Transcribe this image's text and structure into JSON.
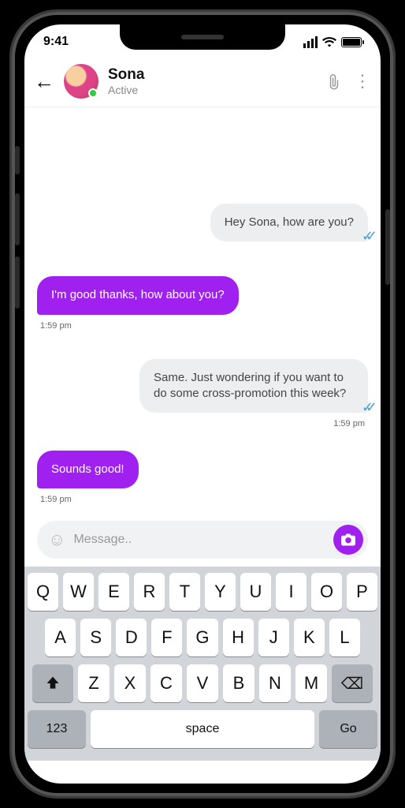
{
  "status": {
    "time": "9:41"
  },
  "header": {
    "name": "Sona",
    "status": "Active"
  },
  "messages": [
    {
      "dir": "out",
      "text": "Hey Sona, how are you?",
      "read": true
    },
    {
      "dir": "in",
      "text": "I'm good thanks, how about you?",
      "time": "1:59 pm"
    },
    {
      "dir": "out",
      "text": "Same.  Just wondering if you want to do some cross-promotion this week?",
      "read": true,
      "time": "1:59 pm"
    },
    {
      "dir": "in",
      "text": "Sounds good!",
      "time": "1:59 pm"
    }
  ],
  "composer": {
    "placeholder": "Message.."
  },
  "keyboard": {
    "row1": [
      "Q",
      "W",
      "E",
      "R",
      "T",
      "Y",
      "U",
      "I",
      "O",
      "P"
    ],
    "row2": [
      "A",
      "S",
      "D",
      "F",
      "G",
      "H",
      "J",
      "K",
      "L"
    ],
    "row3": [
      "Z",
      "X",
      "C",
      "V",
      "B",
      "N",
      "M"
    ],
    "num": "123",
    "space": "space",
    "go": "Go"
  }
}
